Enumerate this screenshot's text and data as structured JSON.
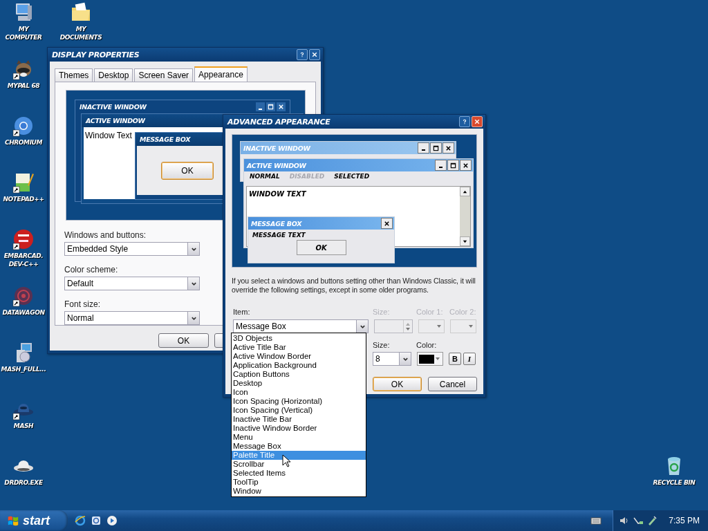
{
  "desktop_icons": [
    {
      "kind": "computer",
      "label": "MY COMPUTER",
      "shortcut": false
    },
    {
      "kind": "documents",
      "label": "MY DOCUMENTS",
      "shortcut": false
    },
    {
      "kind": "raccoon",
      "label": "MYPAL 68",
      "shortcut": true
    },
    {
      "kind": "chromium",
      "label": "CHROMIUM",
      "shortcut": true
    },
    {
      "kind": "notepad",
      "label": "NOTEPAD++",
      "shortcut": true
    },
    {
      "kind": "dev",
      "label": "EMBARCAD. DEV-C++",
      "shortcut": true
    },
    {
      "kind": "datawagon",
      "label": "DATAWAGON",
      "shortcut": true
    },
    {
      "kind": "installer",
      "label": "MASH_FULL...",
      "shortcut": false
    },
    {
      "kind": "hat",
      "label": "MASH",
      "shortcut": true
    },
    {
      "kind": "drone",
      "label": "DRDRO.EXE",
      "shortcut": false
    },
    {
      "kind": "recycle",
      "label": "RECYCLE BIN",
      "shortcut": false
    }
  ],
  "display_properties": {
    "title": "DISPLAY PROPERTIES",
    "tabs": [
      {
        "label": "Themes",
        "selected": false
      },
      {
        "label": "Desktop",
        "selected": false
      },
      {
        "label": "Screen Saver",
        "selected": false
      },
      {
        "label": "Appearance",
        "selected": true
      }
    ],
    "preview": {
      "inactive_title": "INACTIVE WINDOW",
      "active_title": "ACTIVE WINDOW",
      "window_text": "Window Text",
      "message_title": "MESSAGE BOX",
      "ok": "OK"
    },
    "fields": [
      {
        "label": "Windows and buttons:",
        "value": "Embedded Style"
      },
      {
        "label": "Color scheme:",
        "value": "Default"
      },
      {
        "label": "Font size:",
        "value": "Normal"
      }
    ],
    "buttons": [
      "OK"
    ]
  },
  "advanced_appearance": {
    "title": "ADVANCED APPEARANCE",
    "preview": {
      "inactive_title": "INACTIVE WINDOW",
      "active_title": "ACTIVE WINDOW",
      "menu": [
        {
          "kind": "normal",
          "label": "NORMAL"
        },
        {
          "kind": "disabled",
          "label": "DISABLED"
        },
        {
          "kind": "selected",
          "label": "SELECTED"
        }
      ],
      "window_text": "WINDOW TEXT",
      "message_title": "MESSAGE BOX",
      "message_text": "MESSAGE TEXT",
      "ok": "OK"
    },
    "note": "If you select a windows and buttons setting other than Windows Classic, it will override the following settings, except in some older programs.",
    "item_label": "Item:",
    "item_value": "Message Box",
    "size_label": "Size:",
    "color1_label": "Color 1:",
    "color2_label": "Color 2:",
    "item_controls_disabled": true,
    "font_size_label": "Size:",
    "font_size_value": "8",
    "font_color_label": "Color:",
    "bold_label": "B",
    "italic_label": "I",
    "buttons": [
      "OK",
      "Cancel"
    ],
    "item_list": [
      {
        "label": "3D Objects",
        "selected": false
      },
      {
        "label": "Active Title Bar",
        "selected": false
      },
      {
        "label": "Active Window Border",
        "selected": false
      },
      {
        "label": "Application Background",
        "selected": false
      },
      {
        "label": "Caption Buttons",
        "selected": false
      },
      {
        "label": "Desktop",
        "selected": false
      },
      {
        "label": "Icon",
        "selected": false
      },
      {
        "label": "Icon Spacing (Horizontal)",
        "selected": false
      },
      {
        "label": "Icon Spacing (Vertical)",
        "selected": false
      },
      {
        "label": "Inactive Title Bar",
        "selected": false
      },
      {
        "label": "Inactive Window Border",
        "selected": false
      },
      {
        "label": "Menu",
        "selected": false
      },
      {
        "label": "Message Box",
        "selected": false
      },
      {
        "label": "Palette Title",
        "selected": true
      },
      {
        "label": "Scrollbar",
        "selected": false
      },
      {
        "label": "Selected Items",
        "selected": false
      },
      {
        "label": "ToolTip",
        "selected": false
      },
      {
        "label": "Window",
        "selected": false
      }
    ]
  },
  "taskbar": {
    "start": "start",
    "clock": "7:35 PM"
  }
}
